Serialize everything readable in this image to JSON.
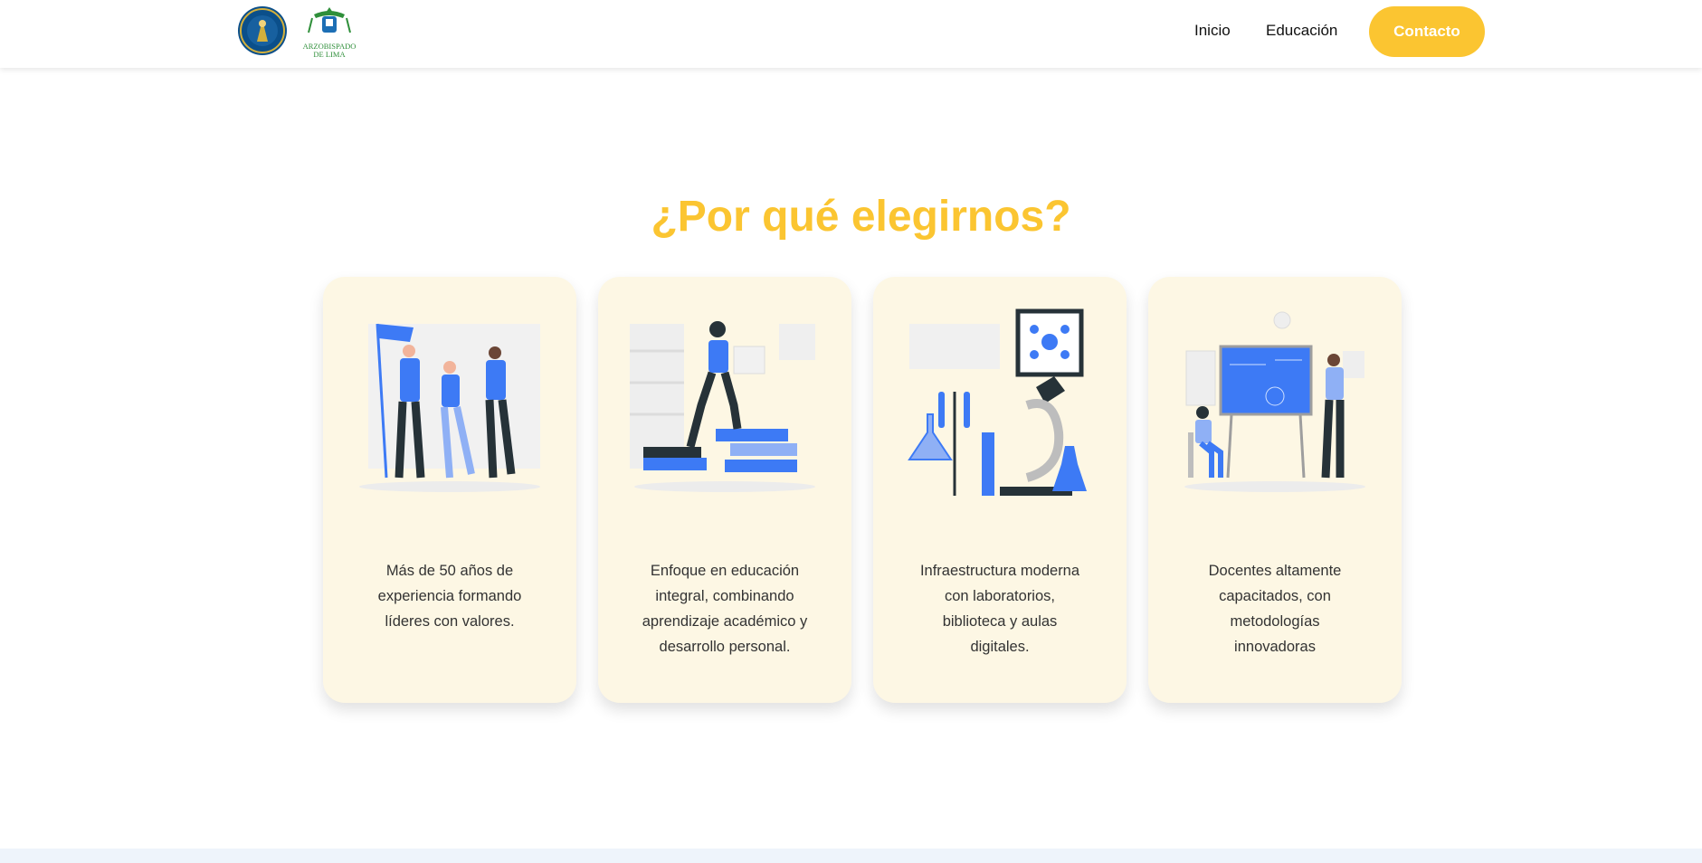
{
  "nav": {
    "logo1_name": "school-crest-logo",
    "logo2_text": "ARZOBISPADO DE LIMA",
    "links": [
      "Inicio",
      "Educación"
    ],
    "contact_label": "Contacto"
  },
  "section": {
    "title": "¿Por qué elegirnos?",
    "cards": [
      {
        "icon": "leaders-team-illustration",
        "text": "Más de 50 años de experiencia formando líderes con valores."
      },
      {
        "icon": "books-stairs-illustration",
        "text": "Enfoque en educación integral, combinando aprendizaje académico y desarrollo personal."
      },
      {
        "icon": "laboratory-illustration",
        "text": "Infraestructura moderna con laboratorios, biblioteca y aulas digitales."
      },
      {
        "icon": "teacher-classroom-illustration",
        "text": "Docentes altamente capacitados, con metodologías innovadoras"
      }
    ]
  },
  "colors": {
    "accent": "#fbc531",
    "card_bg": "#fdf7e4",
    "illustration_blue": "#3d7af5"
  }
}
